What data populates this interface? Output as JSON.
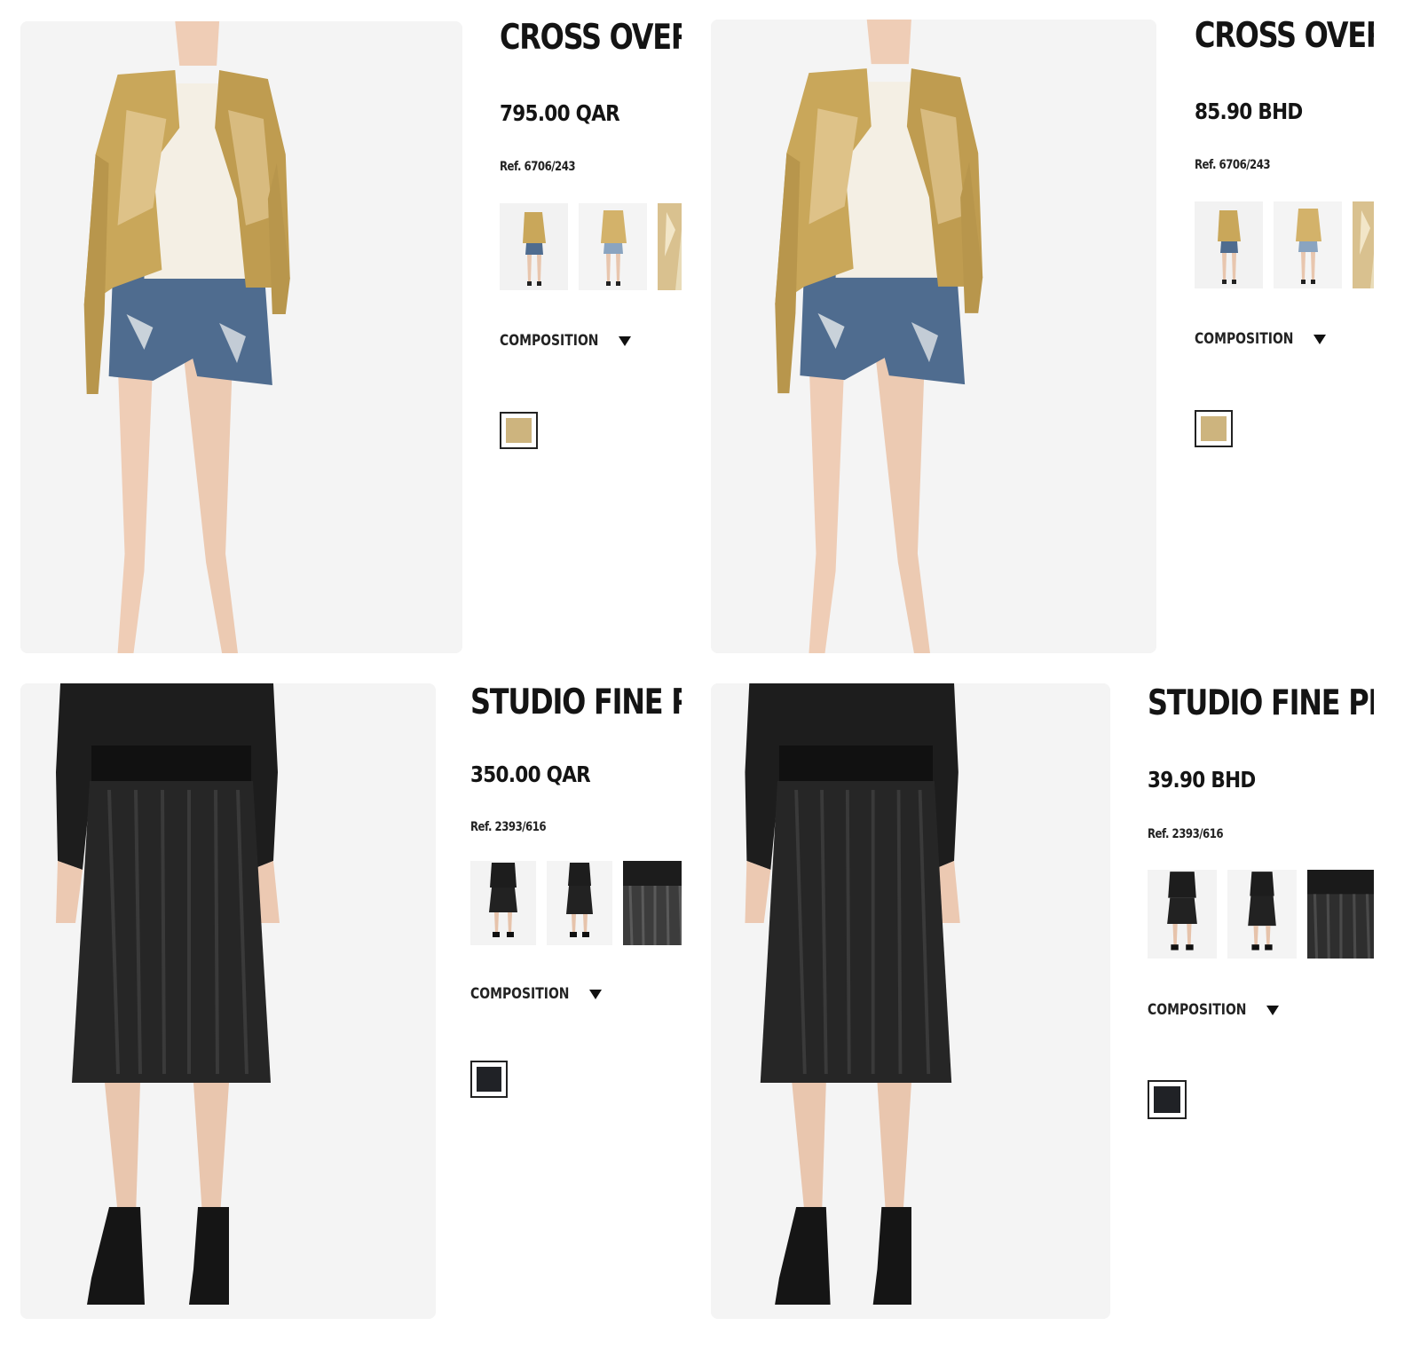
{
  "panels": [
    {
      "title": "CROSS OVER",
      "price": "795.00 QAR",
      "ref": "Ref. 6706/243",
      "composition_label": "COMPOSITION",
      "swatch_color": "#cdb47e",
      "thumb_style": "jacket"
    },
    {
      "title": "CROSS OVER",
      "price": "85.90 BHD",
      "ref": "Ref. 6706/243",
      "composition_label": "COMPOSITION",
      "swatch_color": "#cdb47e",
      "thumb_style": "jacket"
    },
    {
      "title": "STUDIO FINE PLI",
      "price": "350.00 QAR",
      "ref": "Ref. 2393/616",
      "composition_label": "COMPOSITION",
      "swatch_color": "#202226",
      "thumb_style": "skirt"
    },
    {
      "title": "STUDIO FINE PLI",
      "price": "39.90 BHD",
      "ref": "Ref. 2393/616",
      "composition_label": "COMPOSITION",
      "swatch_color": "#202226",
      "thumb_style": "skirt"
    }
  ]
}
